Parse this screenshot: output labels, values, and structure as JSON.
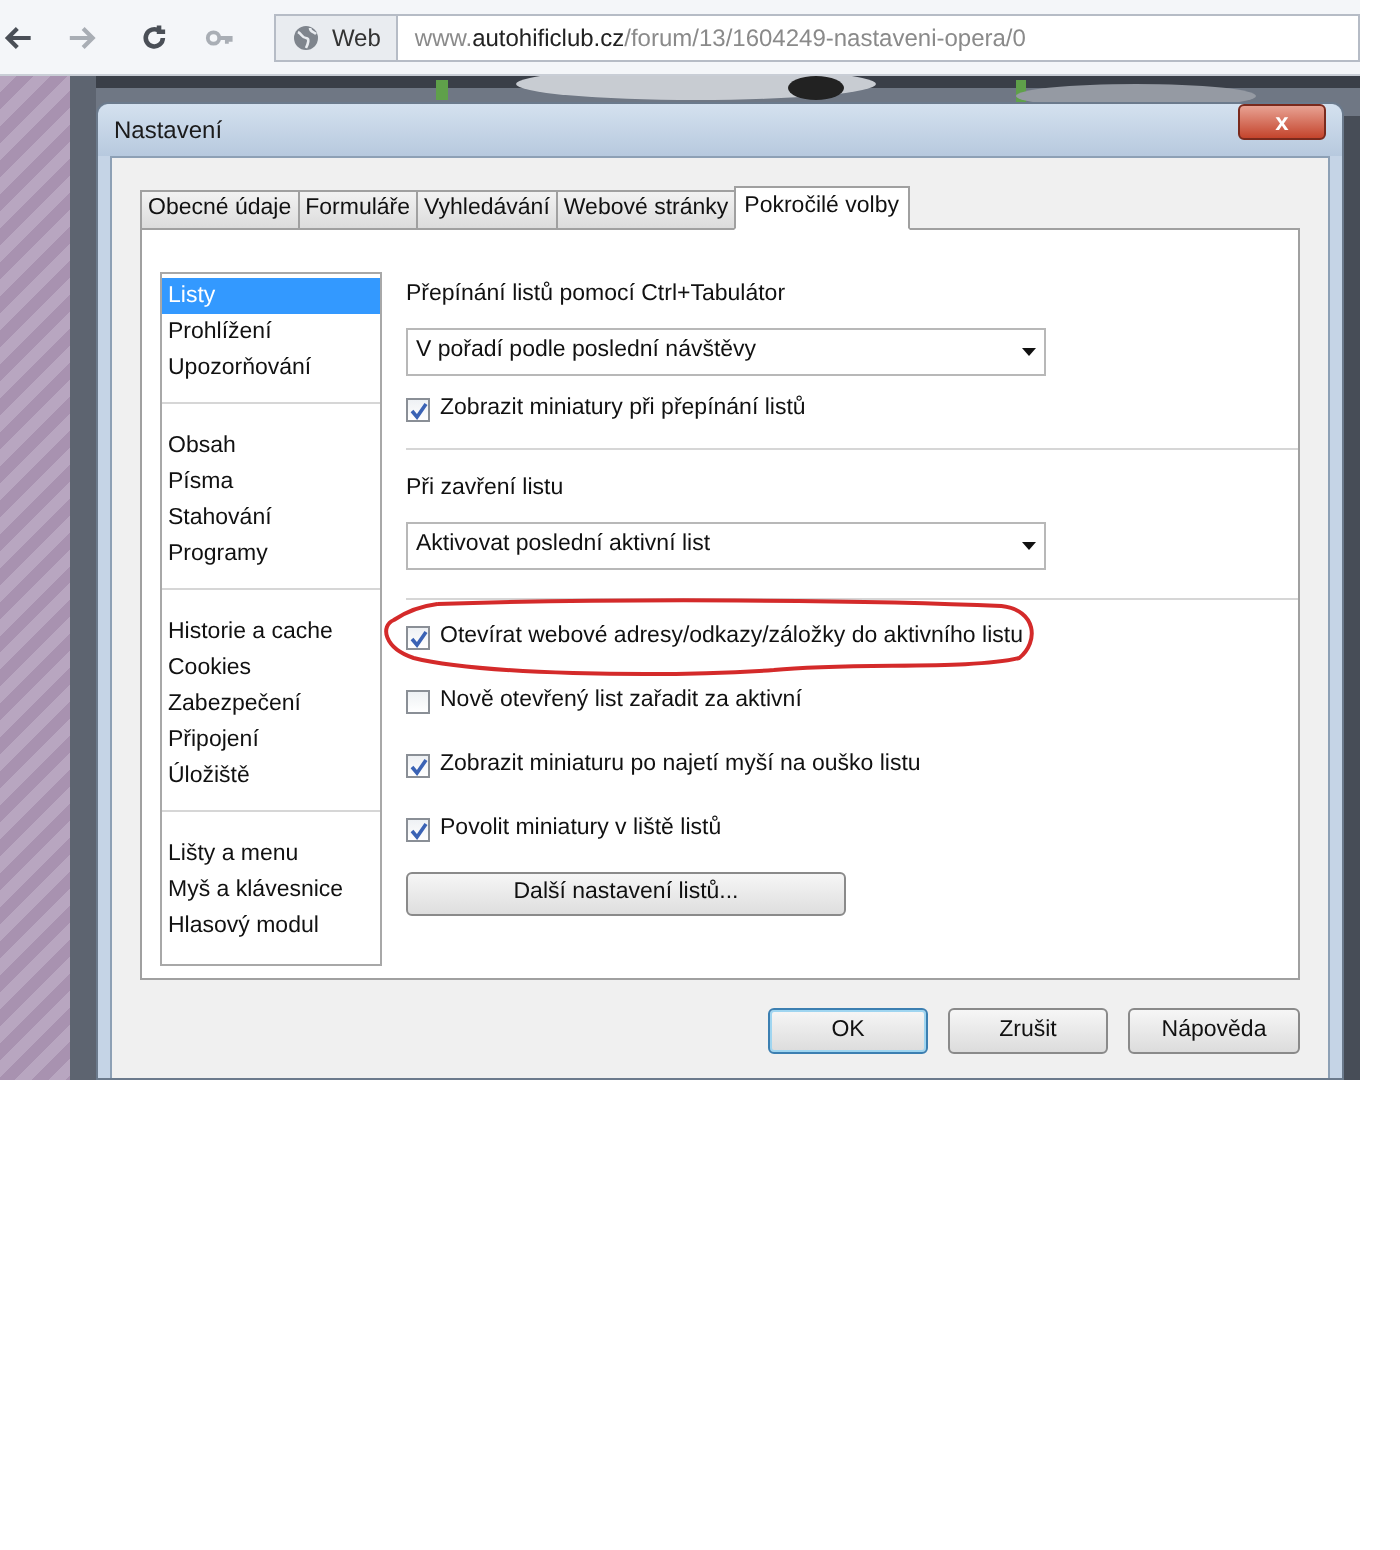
{
  "browser": {
    "nav_buttons": [
      {
        "kind": "back",
        "disabled": false
      },
      {
        "kind": "forward",
        "disabled": true
      },
      {
        "kind": "reload",
        "disabled": false
      },
      {
        "kind": "key",
        "disabled": true
      }
    ],
    "address_bar": {
      "badge": "Web",
      "url_prefix": "www.",
      "url_domain": "autohificlub.cz",
      "url_path": "/forum/13/1604249-nastaveni-opera/0"
    }
  },
  "dialog": {
    "title": "Nastavení",
    "close_button": "x",
    "tabs": [
      {
        "label": "Obecné údaje",
        "selected": false
      },
      {
        "label": "Formuláře",
        "selected": false
      },
      {
        "label": "Vyhledávání",
        "selected": false
      },
      {
        "label": "Webové stránky",
        "selected": false
      },
      {
        "label": "Pokročilé volby",
        "selected": true
      }
    ],
    "sidebar": {
      "groups": [
        {
          "items": [
            {
              "label": "Listy",
              "selected": true
            },
            {
              "label": "Prohlížení",
              "selected": false
            },
            {
              "label": "Upozorňování",
              "selected": false
            }
          ]
        },
        {
          "items": [
            {
              "label": "Obsah",
              "selected": false
            },
            {
              "label": "Písma",
              "selected": false
            },
            {
              "label": "Stahování",
              "selected": false
            },
            {
              "label": "Programy",
              "selected": false
            }
          ]
        },
        {
          "items": [
            {
              "label": "Historie a cache",
              "selected": false
            },
            {
              "label": "Cookies",
              "selected": false
            },
            {
              "label": "Zabezpečení",
              "selected": false
            },
            {
              "label": "Připojení",
              "selected": false
            },
            {
              "label": "Úložiště",
              "selected": false
            }
          ]
        },
        {
          "items": [
            {
              "label": "Lišty a menu",
              "selected": false
            },
            {
              "label": "Myš a klávesnice",
              "selected": false
            },
            {
              "label": "Hlasový modul",
              "selected": false
            }
          ]
        }
      ]
    },
    "sections": [
      {
        "rows": [
          {
            "kind": "label",
            "text": "Přepínání listů pomocí Ctrl+Tabulátor"
          },
          {
            "kind": "dropdown",
            "value": "V pořadí podle poslední návštěvy"
          },
          {
            "kind": "checkbox",
            "text": "Zobrazit miniatury při přepínání listů",
            "checked": true,
            "circled": false
          }
        ]
      },
      {
        "rows": [
          {
            "kind": "label",
            "text": "Při zavření listu"
          },
          {
            "kind": "dropdown",
            "value": "Aktivovat poslední aktivní list"
          }
        ]
      },
      {
        "rows": [
          {
            "kind": "checkbox",
            "text": "Otevírat webové adresy/odkazy/záložky do aktivního listu",
            "checked": true,
            "circled": true
          },
          {
            "kind": "checkbox",
            "text": "Nově otevřený list zařadit za aktivní",
            "checked": false,
            "circled": false
          },
          {
            "kind": "checkbox",
            "text": "Zobrazit miniaturu po najetí myší na ouško listu",
            "checked": true,
            "circled": false
          },
          {
            "kind": "checkbox",
            "text": "Povolit miniatury v liště listů",
            "checked": true,
            "circled": false
          },
          {
            "kind": "button",
            "text": "Další nastavení listů..."
          }
        ]
      }
    ],
    "buttons": [
      {
        "label": "OK",
        "default": true
      },
      {
        "label": "Zrušit",
        "default": false
      },
      {
        "label": "Nápověda",
        "default": false
      }
    ]
  }
}
